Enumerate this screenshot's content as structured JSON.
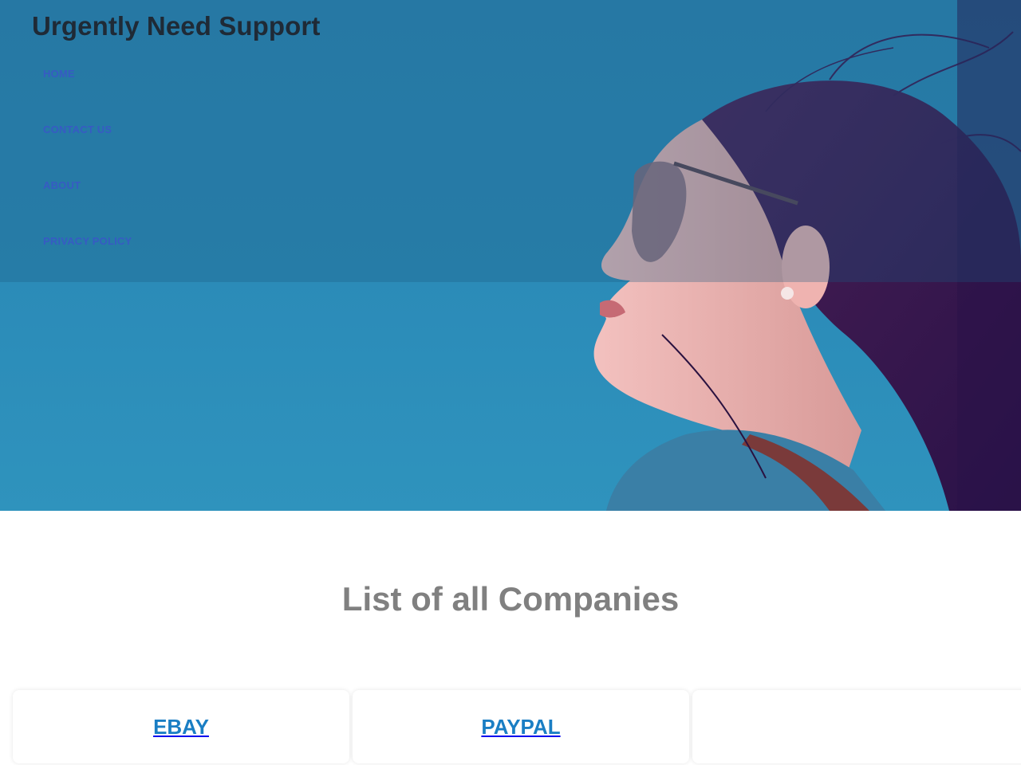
{
  "site": {
    "title": "Urgently Need Support"
  },
  "nav": {
    "items": [
      {
        "label": "HOME"
      },
      {
        "label": "CONTACT US"
      },
      {
        "label": "ABOUT"
      },
      {
        "label": "PRIVACY POLICY"
      }
    ]
  },
  "main": {
    "heading": "List of all Companies",
    "companies": [
      {
        "name": "EBAY"
      },
      {
        "name": "PAYPAL"
      },
      {
        "name": ""
      }
    ]
  },
  "colors": {
    "hero_sky": "#2b8bb8",
    "title_text": "#1f2a36",
    "nav_link": "#3a56c9",
    "heading_text": "#808080",
    "company_link": "#1a7ec4"
  }
}
